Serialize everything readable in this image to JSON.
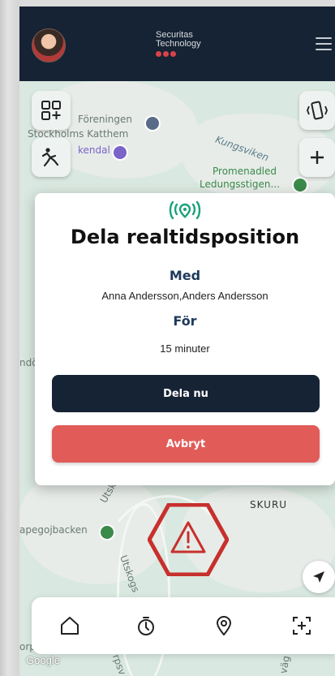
{
  "header": {
    "brand_line1": "Securitas",
    "brand_line2": "Technology",
    "brand_color": "#d8434a",
    "background": "#162334"
  },
  "map": {
    "labels": [
      "Föreningen",
      "Stockholms Katthem",
      "kendal",
      "Kungsviken",
      "Promenadled",
      "Ledungsstigen...",
      "ndö",
      "SKURU",
      "apegojbacken",
      "Utsk",
      "Utskogs",
      "orp",
      "rpsv",
      "väg"
    ],
    "attribution": "Google"
  },
  "dialog": {
    "icon": "broadcast-location-icon",
    "title": "Dela realtidsposition",
    "with_label": "Med",
    "with_value": "Anna Andersson,Anders Andersson",
    "for_label": "För",
    "for_value": "15 minuter",
    "share_label": "Dela nu",
    "cancel_label": "Avbryt",
    "accent": "#203a5c",
    "cancel_color": "#e15b58"
  },
  "bottom_nav": {
    "items": [
      "home-icon",
      "timer-icon",
      "location-pin-icon",
      "add-frame-icon"
    ]
  }
}
